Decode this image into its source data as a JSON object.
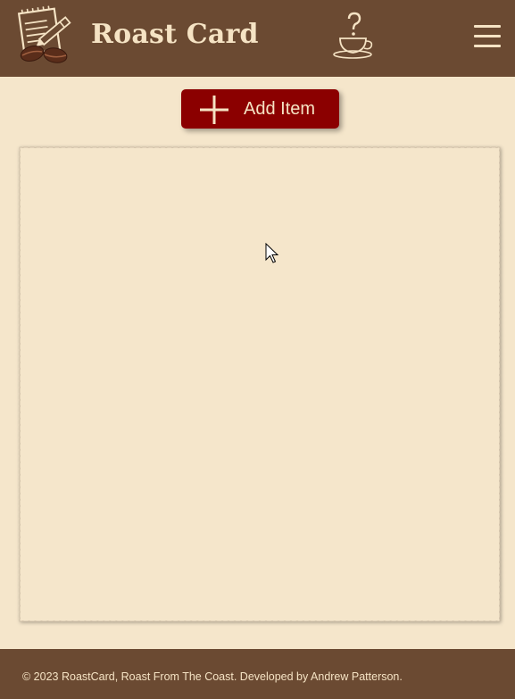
{
  "header": {
    "brand": "Roast Card",
    "logo_icon": "notepad-pencil-coffee-beans-icon",
    "cup_icon": "coffee-cup-question-icon",
    "menu_icon": "hamburger-menu-icon"
  },
  "toolbar": {
    "add_label": "Add Item",
    "add_icon": "plus-icon"
  },
  "card": {
    "items": []
  },
  "footer": {
    "text": "© 2023 RoastCard, Roast From The Coast. Developed by Andrew Patterson."
  },
  "colors": {
    "background": "#f5e6cb",
    "header": "#6b4a32",
    "accent": "#8b0000",
    "text_light": "#f5e3c4"
  }
}
